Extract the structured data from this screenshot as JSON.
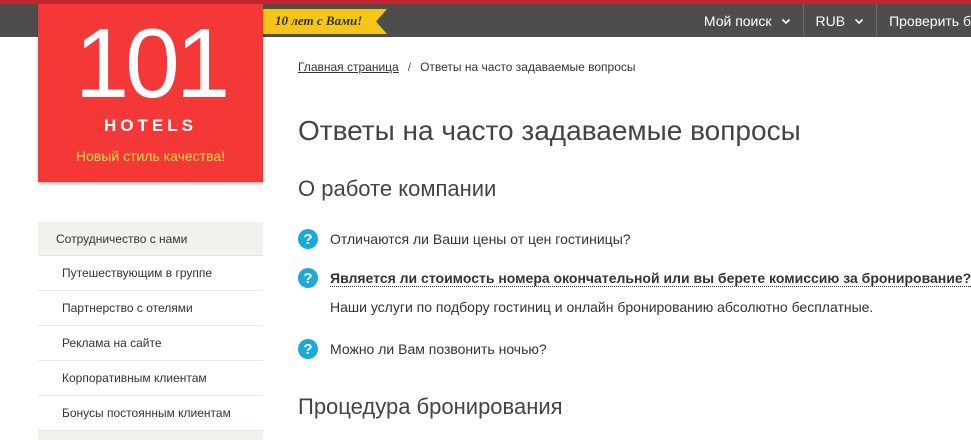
{
  "header": {
    "badge": "10 лет с Вами!",
    "nav": [
      {
        "label": "Мой поиск"
      },
      {
        "label": "RUB"
      },
      {
        "label": "Проверить б"
      }
    ]
  },
  "logo": {
    "digits": "101",
    "name": "HOTELS",
    "slogan": "Новый стиль качества!"
  },
  "sidebar": {
    "heading": "Сотрудничество с нами",
    "items": [
      {
        "label": "Путешествующим в группе"
      },
      {
        "label": "Партнерство с отелями"
      },
      {
        "label": "Реклама на сайте"
      },
      {
        "label": "Корпоративным клиентам"
      },
      {
        "label": "Бонусы постоянным клиентам"
      }
    ]
  },
  "breadcrumb": {
    "home": "Главная страница",
    "separator": "/",
    "current": "Ответы на часто задаваемые вопросы"
  },
  "main": {
    "title": "Ответы на часто задаваемые вопросы",
    "sections": [
      {
        "title": "О работе компании",
        "questions": [
          {
            "q": "Отличаются ли Ваши цены от цен гостиницы?"
          },
          {
            "q": "Является ли стоимость номера окончательной или вы берете комиссию за бронирование?",
            "answer": "Наши услуги по подбору гостиниц и онлайн бронированию абсолютно бесплатные."
          },
          {
            "q": "Можно ли Вам позвонить ночью?"
          }
        ]
      },
      {
        "title": "Процедура бронирования"
      }
    ],
    "q_glyph": "?"
  },
  "colors": {
    "topbar": "#4d4d4d",
    "accent_line": "#c4242f",
    "logo_bg": "#f43737",
    "slogan": "#ffd84a",
    "badge_bg": "#f5c518",
    "question_icon": "#1aa9d8"
  }
}
